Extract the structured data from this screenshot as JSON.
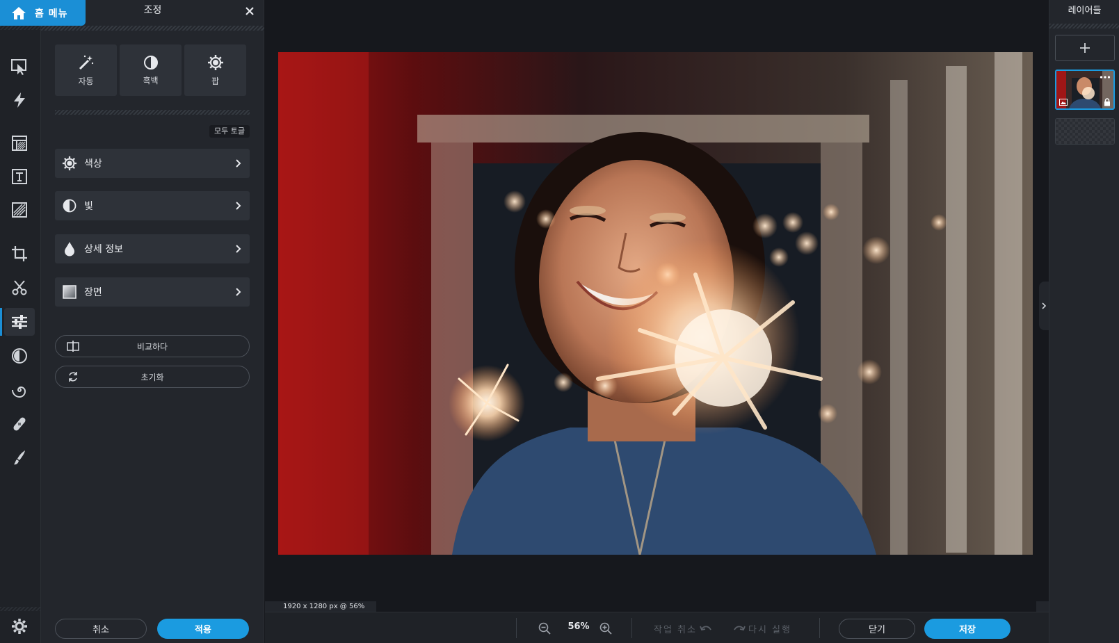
{
  "home": {
    "label": "홈 메뉴"
  },
  "panel": {
    "title": "조정",
    "quick": [
      {
        "label": "자동",
        "icon": "magic-wand-icon"
      },
      {
        "label": "흑백",
        "icon": "half-circle-icon"
      },
      {
        "label": "팝",
        "icon": "gear-sun-icon"
      }
    ],
    "toggle_all": "모두 토글",
    "categories": [
      {
        "label": "색상",
        "icon": "color-gear-icon"
      },
      {
        "label": "빛",
        "icon": "light-half-icon"
      },
      {
        "label": "상세 정보",
        "icon": "drop-icon"
      },
      {
        "label": "장면",
        "icon": "scene-square-icon"
      }
    ],
    "compare": "비교하다",
    "reset": "초기화",
    "cancel": "취소",
    "apply": "적용"
  },
  "canvas": {
    "info": "1920 x 1280 px @ 56%"
  },
  "bottombar": {
    "zoom": "56%",
    "undo": "작업 취소",
    "redo": "다시 실행",
    "close": "닫기",
    "save": "저장"
  },
  "layers": {
    "title": "레이어들"
  },
  "colors": {
    "accent": "#1b9be0",
    "home": "#1b8fd6",
    "panel": "#23262c",
    "rail": "#1f2227",
    "canvas": "#16181d"
  }
}
